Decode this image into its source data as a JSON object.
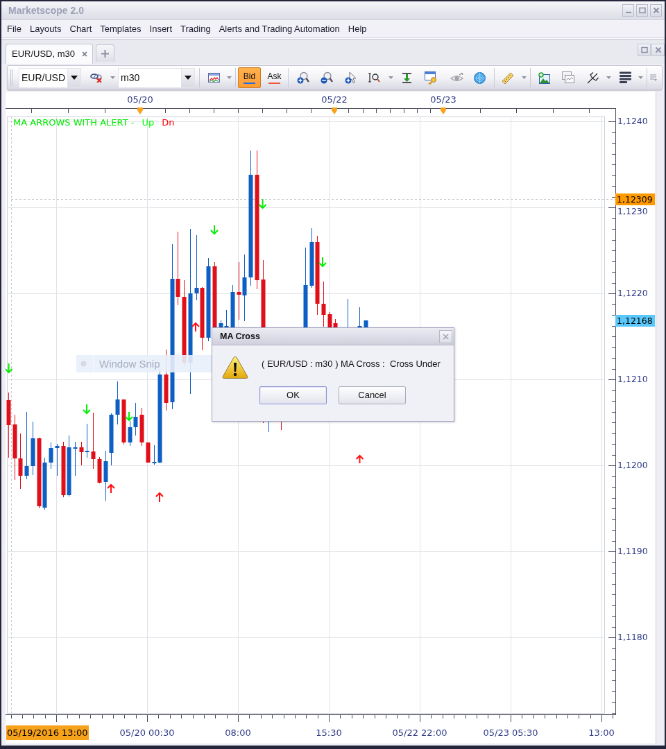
{
  "window": {
    "title": "Marketscope 2.0"
  },
  "menu": [
    "File",
    "Layouts",
    "Chart",
    "Templates",
    "Insert",
    "Trading",
    "Alerts and Trading Automation",
    "Help"
  ],
  "tabs": [
    {
      "label": "EUR/USD, m30",
      "selected": true
    }
  ],
  "toolbar": {
    "symbol": "EUR/USD",
    "timeframe": "m30",
    "price_modes": [
      {
        "label": "Bid",
        "selected": true
      },
      {
        "label": "Ask",
        "selected": false
      }
    ]
  },
  "chart": {
    "date_labels": [
      "05/20",
      "05/22",
      "05/23"
    ],
    "legend": {
      "title": "MA ARROWS WITH ALERT -",
      "items": [
        {
          "label": "Up",
          "color": "#00ff00"
        },
        {
          "label": "Dn",
          "color": "#ff0000"
        }
      ]
    },
    "price_labels": [
      "1,1240",
      "1,1230",
      "1,1220",
      "1,1210",
      "1,1200",
      "1,1190",
      "1,1180"
    ],
    "price_tags": [
      {
        "text": "1,12309",
        "color": "#ff9900"
      },
      {
        "text": "1,12168",
        "color": "#5ac8fa"
      }
    ],
    "cursor_time": "05/19/2016 13:00",
    "time_labels": [
      "05/20 00:30",
      "08:00",
      "15:30",
      "05/22 22:00",
      "05/23 05:30",
      "13:00"
    ]
  },
  "snip_overlay": {
    "label": "Window Snip"
  },
  "dialog": {
    "title": "MA Cross",
    "message": "( EUR/USD : m30 ) MA Cross :  Cross Under",
    "buttons": [
      {
        "label": "OK",
        "default": true
      },
      {
        "label": "Cancel",
        "default": false
      }
    ]
  }
}
